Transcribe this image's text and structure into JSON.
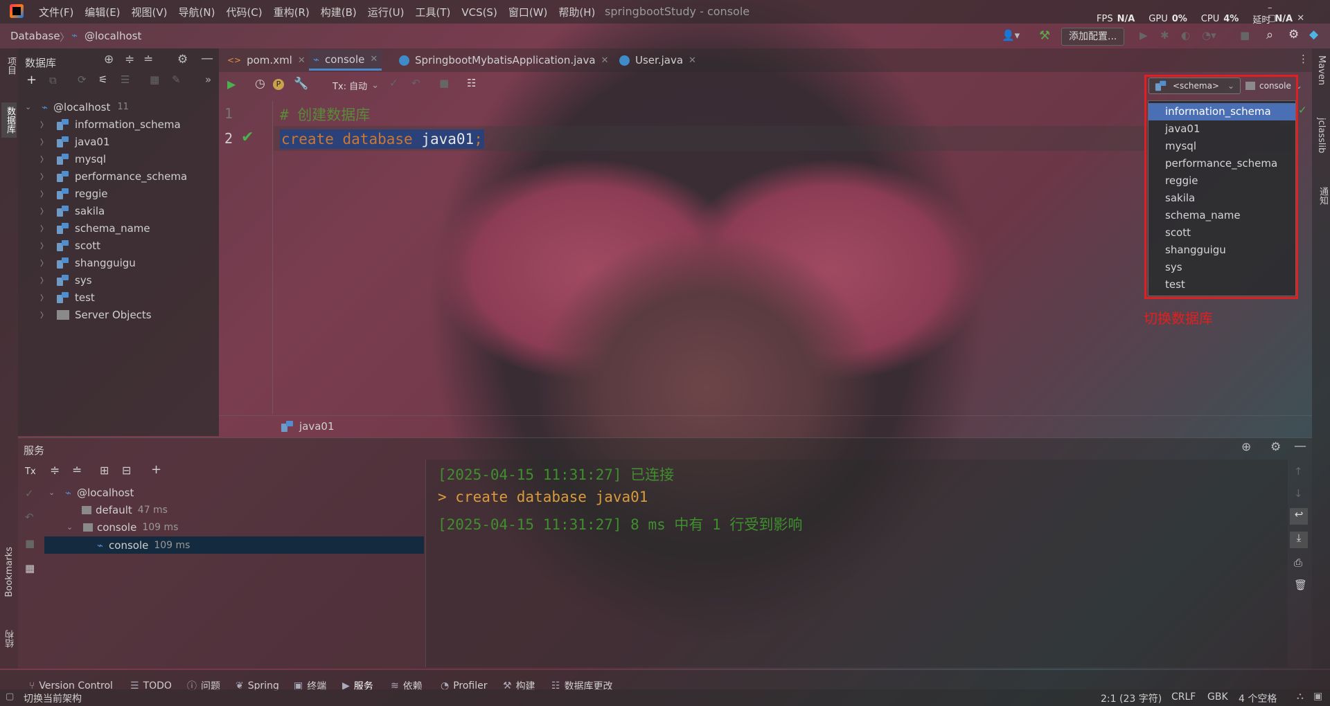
{
  "menu": {
    "items": [
      "文件(F)",
      "编辑(E)",
      "视图(V)",
      "导航(N)",
      "代码(C)",
      "重构(R)",
      "构建(B)",
      "运行(U)",
      "工具(T)",
      "VCS(S)",
      "窗口(W)",
      "帮助(H)"
    ],
    "title": "springbootStudy - console"
  },
  "perf": {
    "fps_label": "FPS",
    "fps": "N/A",
    "gpu_label": "GPU",
    "gpu": "0%",
    "cpu_label": "CPU",
    "cpu": "4%",
    "delay_label": "延时",
    "delay": "N/A"
  },
  "nav": {
    "crumb1": "Database",
    "crumb2": "@localhost",
    "add_config": "添加配置..."
  },
  "db_panel": {
    "title": "数据库",
    "host": "@localhost",
    "count": "11",
    "schemas": [
      "information_schema",
      "java01",
      "mysql",
      "performance_schema",
      "reggie",
      "sakila",
      "schema_name",
      "scott",
      "shangguigu",
      "sys",
      "test"
    ],
    "server_objects": "Server Objects"
  },
  "tabs": [
    "pom.xml",
    "console",
    "SpringbootMybatisApplication.java",
    "User.java"
  ],
  "editor": {
    "tx_label": "Tx: 自动",
    "line1": "1",
    "line2": "2",
    "comment": "# 创建数据库",
    "kw1": "create",
    "kw2": "database",
    "ident": "java01",
    "semi": ";",
    "context": "java01"
  },
  "schema_selector": {
    "schema": "<schema>",
    "console": "console",
    "options": [
      "information_schema",
      "java01",
      "mysql",
      "performance_schema",
      "reggie",
      "sakila",
      "schema_name",
      "scott",
      "shangguigu",
      "sys",
      "test"
    ],
    "selected": "information_schema",
    "annotation": "切换数据库"
  },
  "services": {
    "title": "服务",
    "tx": "Tx",
    "host": "@localhost",
    "default": "default",
    "default_time": "47 ms",
    "console": "console",
    "console_time": "109 ms",
    "console_child": "console",
    "console_child_time": "109 ms"
  },
  "output": {
    "line1_ts": "[2025-04-15 11:31:27]",
    "line1_msg": "已连接",
    "line2": "> create database java01",
    "line3_ts": "[2025-04-15 11:31:27]",
    "line3_msg": "8 ms 中有 1 行受到影响"
  },
  "bottom_tabs": [
    "Version Control",
    "TODO",
    "问题",
    "Spring",
    "终端",
    "服务",
    "依赖",
    "Profiler",
    "构建",
    "数据库更改"
  ],
  "status": {
    "left": "切换当前架构",
    "pos": "2:1 (23 字符)",
    "eol": "CRLF",
    "enc": "GBK",
    "indent": "4 个空格"
  },
  "left_strip": {
    "project": "项目",
    "db": "数据库",
    "bookmarks": "Bookmarks",
    "structure": "结构"
  },
  "right_strip": {
    "maven": "Maven",
    "jclasslib": "jclasslib",
    "notify": "通知"
  },
  "colors": {
    "accent": "#4a6fb5",
    "keyword": "#cc7832",
    "comment": "#629755",
    "green": "#3f8f2e",
    "annotation": "#e02020"
  }
}
